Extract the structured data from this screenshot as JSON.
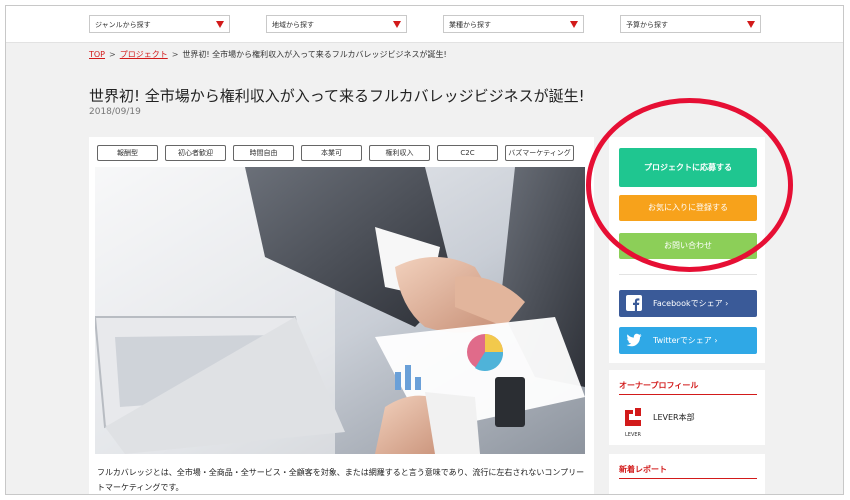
{
  "filters": [
    {
      "label": "ジャンルから探す"
    },
    {
      "label": "地域から探す"
    },
    {
      "label": "業種から探す"
    },
    {
      "label": "予算から探す"
    }
  ],
  "breadcrumb": {
    "top": "TOP",
    "project": "プロジェクト",
    "sep": ">",
    "current": "世界初! 全市場から権利収入が入って来るフルカバレッジビジネスが誕生!"
  },
  "article": {
    "title": "世界初! 全市場から権利収入が入って来るフルカバレッジビジネスが誕生!",
    "date": "2018/09/19",
    "tags": [
      "報酬型",
      "初心者歓迎",
      "時間自由",
      "本業可",
      "権利収入",
      "C2C",
      "バズマーケティング"
    ],
    "description": "フルカバレッジとは、全市場・全商品・全サービス・全顧客を対象、または網羅すると言う意味であり、流行に左右されないコンプリートマーケティングです。"
  },
  "sidebar": {
    "apply_label": "プロジェクトに応募する",
    "favorite_label": "お気に入りに登録する",
    "contact_label": "お問い合わせ",
    "facebook_label": "Facebookでシェア ›",
    "twitter_label": "Twitterでシェア ›",
    "owner_title": "オーナープロフィール",
    "owner_name": "LEVER本部",
    "owner_logo_text": "LEVER",
    "report_title": "新着レポート"
  },
  "colors": {
    "accent_red": "#d21a1a",
    "apply": "#1fc690",
    "favorite": "#f7a21b",
    "contact": "#8ccf58",
    "facebook": "#3a5a98",
    "twitter": "#2fa8e6",
    "highlight": "#e60f34"
  },
  "icons": [
    "chevron-down-icon",
    "facebook-icon",
    "twitter-icon",
    "lever-logo-icon"
  ]
}
